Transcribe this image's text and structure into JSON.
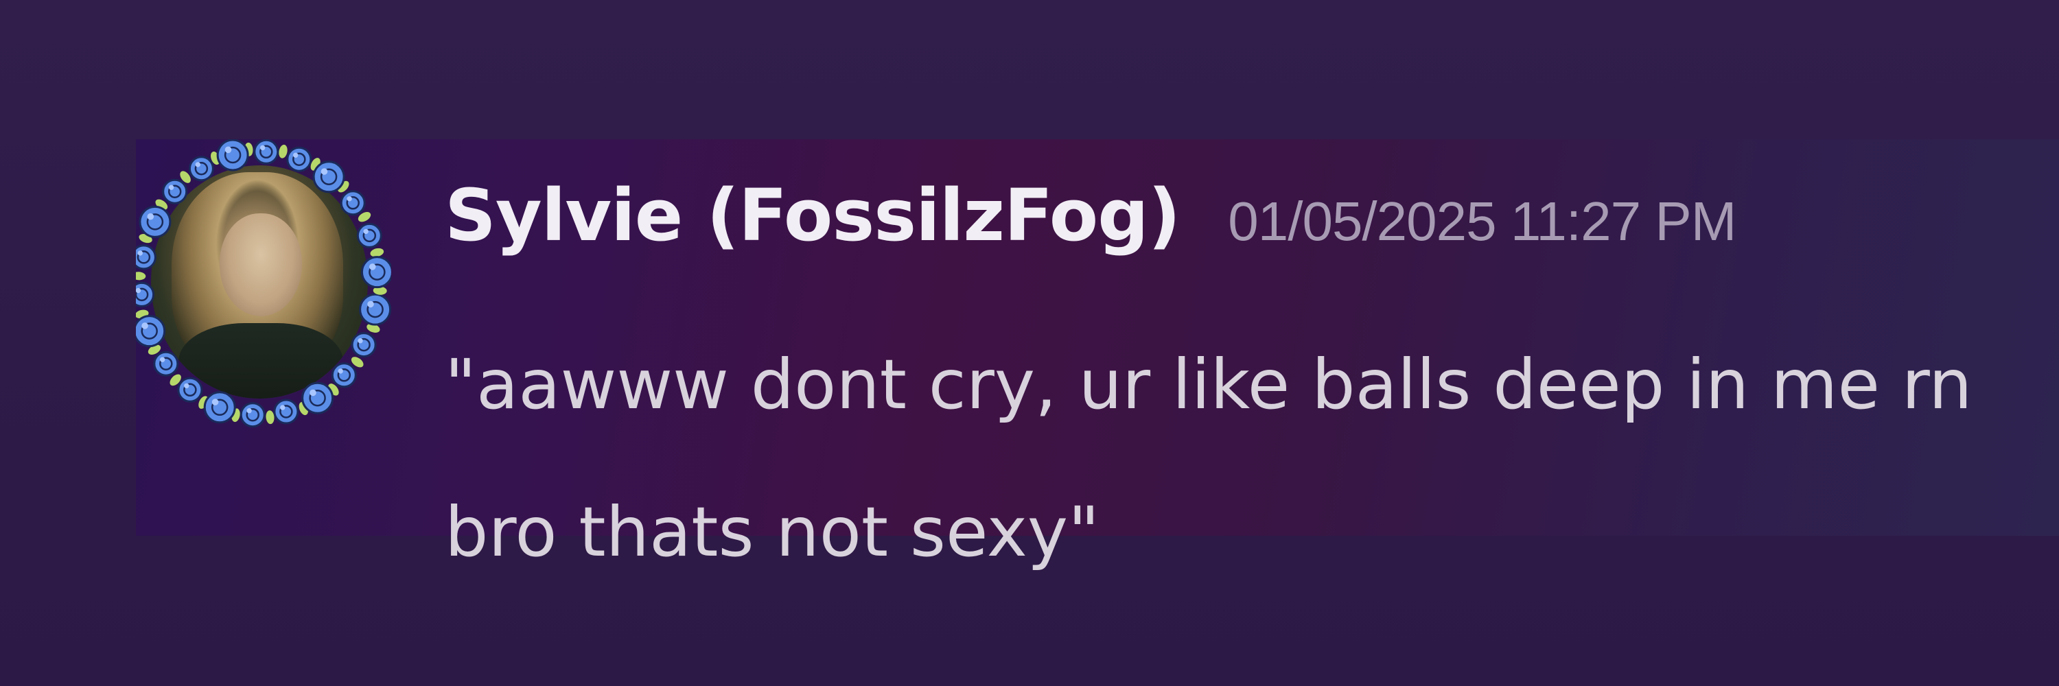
{
  "message": {
    "author": "Sylvie (FossilzFog)",
    "timestamp": "01/05/2025 11:27 PM",
    "content_lines": [
      "\"aawww dont cry, ur like balls deep in me rn",
      "bro thats not sexy\""
    ],
    "avatar": {
      "icon": "user-avatar",
      "decoration_icon": "blue-rose-wreath-icon"
    }
  },
  "colors": {
    "background": "#301c49",
    "username": "#f2eef5",
    "timestamp": "#a79bb3",
    "message_text": "#d8d2dc",
    "rose_blue": "#5b8ee8",
    "leaf_green": "#b6d86a"
  }
}
